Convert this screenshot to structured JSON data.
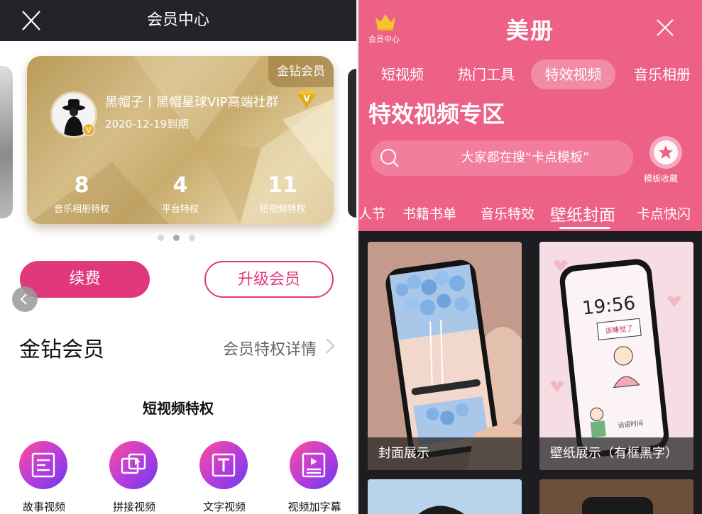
{
  "left": {
    "header": {
      "title": "会员中心"
    },
    "card": {
      "badge": "金钻会员",
      "name": "黑帽子丨黑帽星球VIP高端社群",
      "expiry": "2020-12-19到期",
      "avatar_badge": "V",
      "stats": [
        {
          "value": "8",
          "label": "音乐相册特权"
        },
        {
          "value": "4",
          "label": "平台特权"
        },
        {
          "value": "11",
          "label": "短视频特权"
        }
      ]
    },
    "carousel": {
      "page": 2,
      "total": 3
    },
    "buttons": {
      "renew": "续费",
      "upgrade": "升级会员"
    },
    "section": {
      "title": "金钻会员",
      "link": "会员特权详情"
    },
    "subsection": {
      "title": "短视频特权"
    },
    "features": [
      {
        "label": "故事视频",
        "icon": "story-video-icon"
      },
      {
        "label": "拼接视频",
        "icon": "splice-video-icon"
      },
      {
        "label": "文字视频",
        "icon": "text-video-icon"
      },
      {
        "label": "视频加字幕",
        "icon": "subtitle-video-icon"
      }
    ]
  },
  "right": {
    "header": {
      "logo": "美册",
      "crown_label": "会员中心"
    },
    "tabs": [
      {
        "label": "短视频",
        "active": false
      },
      {
        "label": "热门工具",
        "active": false
      },
      {
        "label": "特效视频",
        "active": true
      },
      {
        "label": "音乐相册",
        "active": false
      }
    ],
    "zone_title": "特效视频专区",
    "search": {
      "placeholder": "大家都在搜“卡点模板”"
    },
    "favorite": {
      "label": "模板收藏"
    },
    "categories": [
      {
        "label": "人节",
        "active": false
      },
      {
        "label": "书籍书单",
        "active": false
      },
      {
        "label": "音乐特效",
        "active": false
      },
      {
        "label": "壁纸封面",
        "active": true
      },
      {
        "label": "卡点快闪",
        "active": false
      }
    ],
    "tiles": [
      {
        "caption": "封面展示"
      },
      {
        "caption": "壁纸展示（有框黑字）"
      }
    ],
    "tile_screen": {
      "time": "19:56",
      "note": "该睡觉了",
      "sign": "话语时间"
    }
  },
  "colors": {
    "accent_pink": "#e0387b",
    "header_dark": "#23232a",
    "meice_pink": "#ee6187",
    "gold": "#d6bd87"
  }
}
